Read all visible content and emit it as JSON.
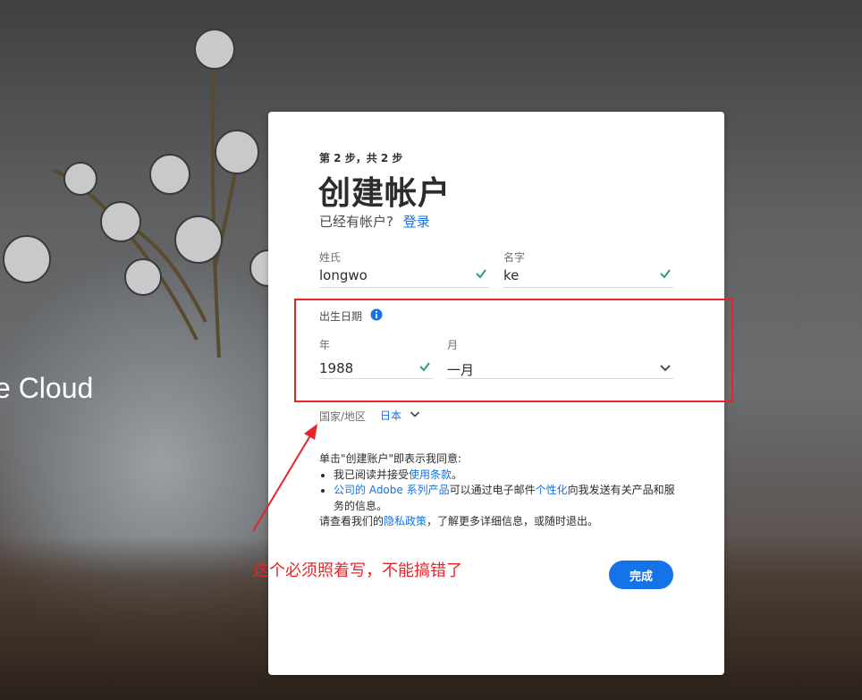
{
  "background": {
    "brand_text": "e Cloud"
  },
  "form": {
    "step": "第 2 步，共 2 步",
    "title": "创建帐户",
    "has_account": "已经有帐户?",
    "login": "登录",
    "last_name": {
      "label": "姓氏",
      "value": "longwo"
    },
    "first_name": {
      "label": "名字",
      "value": "ke"
    },
    "dob_label": "出生日期",
    "year": {
      "label": "年",
      "value": "1988"
    },
    "month": {
      "label": "月",
      "value": "一月"
    },
    "country_label": "国家/地区",
    "country_value": "日本",
    "terms": {
      "intro": "单击\"创建账户\"即表示我同意:",
      "item1_text": "我已阅读并接受",
      "item1_link": "使用条款",
      "item1_end": "。",
      "item2_link1": "公司的 Adobe 系列产品",
      "item2_text1": "可以通过电子邮件",
      "item2_link2": "个性化",
      "item2_text2": "向我发送有关产品和服务的信息。",
      "outro_text1": "请查看我们的",
      "outro_link": "隐私政策",
      "outro_text2": "，了解更多详细信息，或随时退出。"
    },
    "finish_button": "完成"
  },
  "annotation": {
    "text": "这个必须照着写，不能搞错了"
  },
  "colors": {
    "accent": "#1473e6",
    "check": "#2d9d78",
    "annotation": "#e8232a"
  }
}
